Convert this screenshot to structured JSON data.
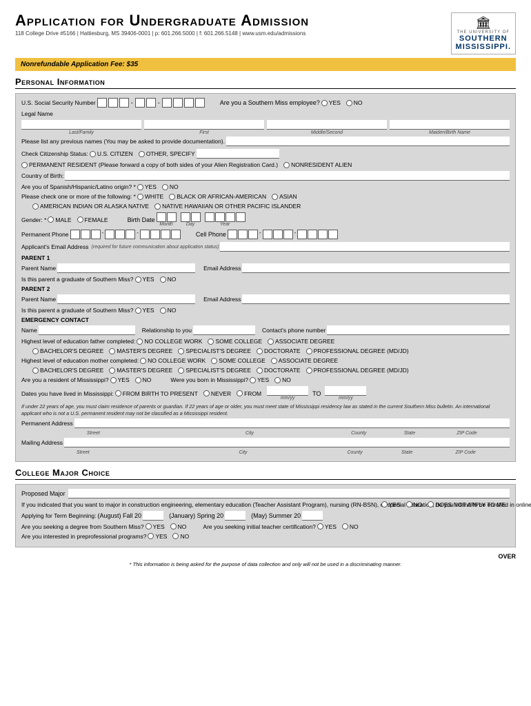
{
  "header": {
    "title": "Application for Undergraduate Admission",
    "address": "118 College Drive #5166 | Hattiesburg, MS 39406-0001 | p: 601.266.5000 | f: 601.266.5148 | www.usm.edu/admissions",
    "logo_top": "THE UNIVERSITY OF",
    "logo_line1": "SOUTHERN",
    "logo_line2": "MISSISSIPPI."
  },
  "fee_bar": "Nonrefundable Application Fee: $35",
  "personal_info_title": "Personal Information",
  "ssn_label": "U.S. Social Security Number",
  "southern_miss_employee": "Are you a Southern Miss employee?",
  "yes": "YES",
  "no": "NO",
  "legal_name_label": "Legal Name",
  "last_family": "Last/Family",
  "first": "First",
  "middle_second": "Middle/Second",
  "maiden_birth": "Maiden/Birth Name",
  "previous_names_label": "Please list any previous names (You may be asked to provide documentation).",
  "citizenship_label": "Check Citizenship Status:",
  "us_citizen": "U.S. CITIZEN",
  "other_specify": "OTHER, SPECIFY",
  "permanent_resident": "PERMANENT RESIDENT (Please forward a copy of both sides of your Alien Registration Card.)",
  "nonresident_alien": "NONRESIDENT ALIEN",
  "country_birth_label": "Country of Birth:",
  "spanish_label": "Are you of Spanish/Hispanic/Latino origin? *",
  "check_one_label": "Please check one or more of the following: *",
  "white": "WHITE",
  "black_african": "BLACK OR AFRICAN-AMERICAN",
  "asian": "ASIAN",
  "american_indian": "AMERICAN INDIAN OR ALASKA NATIVE",
  "pacific_islander": "NATIVE HAWAIIAN OR OTHER PACIFIC ISLANDER",
  "gender_label": "Gender: *",
  "male": "MALE",
  "female": "FEMALE",
  "birth_date_label": "Birth Date",
  "month": "Month",
  "day": "Day",
  "year": "Year",
  "permanent_phone_label": "Permanent Phone",
  "cell_phone_label": "Cell Phone",
  "email_label": "Applicant's Email Address",
  "email_note": "(required for future communication about application status)",
  "parent1_label": "PARENT 1",
  "parent_name_label": "Parent Name",
  "email_address_label": "Email Address",
  "graduate_label": "Is this parent a graduate of Southern Miss?",
  "parent2_label": "PARENT 2",
  "emergency_label": "EMERGENCY CONTACT",
  "name_label": "Name",
  "relationship_label": "Relationship to you",
  "contact_phone_label": "Contact's phone number",
  "father_edu_label": "Highest level of education father completed:",
  "no_college_work": "NO COLLEGE WORK",
  "some_college": "SOME COLLEGE",
  "associate_degree": "ASSOCIATE DEGREE",
  "bachelors_degree": "BACHELOR'S DEGREE",
  "masters_degree": "MASTER'S DEGREE",
  "specialist_degree": "SPECIALIST'S DEGREE",
  "doctorate": "DOCTORATE",
  "professional_degree": "PROFESSIONAL DEGREE (MD/JD)",
  "mother_edu_label": "Highest level of education mother completed:",
  "ms_resident_label": "Are you a resident of Mississippi?",
  "ms_born_label": "Were you born in Mississippi?",
  "ms_dates_label": "Dates you have lived in Mississippi:",
  "from_birth": "FROM BIRTH TO PRESENT",
  "never": "NEVER",
  "from": "FROM",
  "to": "TO",
  "mm_yy": "mm/yy",
  "residency_note": "If under 22 years of age, you must claim residence of parents or guardian. If 22 years of age or older, you must meet state of Mississippi residency law as stated in the current Southern Miss bulletin. An international applicant who is not a U.S. permanent resident may not be classified as a Mississippi resident.",
  "permanent_address_label": "Permanent Address",
  "mailing_address_label": "Mailing Address",
  "addr_street": "Street",
  "addr_city": "City",
  "addr_county": "County",
  "addr_state": "State",
  "addr_zip": "ZIP Code",
  "college_major_title": "College Major Choice",
  "proposed_major_label": "Proposed Major",
  "online_note": "If you indicated that you want to major in construction engineering, elementary education (Teacher Assistant Program), nursing (RN-BSN), or special education, do you intend to be enrolled in online classes only?",
  "does_not_apply": "DOES NOT APPLY TO ME",
  "term_label": "Applying for Term Beginning:",
  "aug_fall": "(August) Fall 20",
  "jan_spring": "(January) Spring 20",
  "may_summer": "(May) Summer 20",
  "degree_label": "Are you seeking a degree from Southern Miss?",
  "teacher_cert_label": "Are you seeking initial teacher certification?",
  "preprofessional_label": "Are you interested in preprofessional programs?",
  "over_text": "OVER",
  "disclaimer": "* This information is being asked for the purpose of data collection and only will not be used in a discriminating manner."
}
